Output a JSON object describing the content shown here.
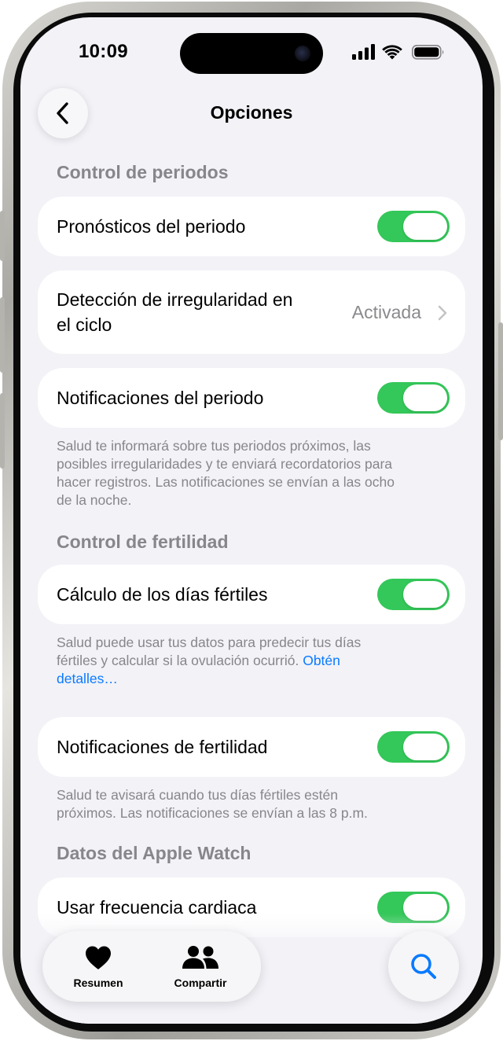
{
  "status_bar": {
    "time": "10:09"
  },
  "nav": {
    "title": "Opciones",
    "back": "back"
  },
  "sections": {
    "period": {
      "header": "Control de periodos",
      "forecasts": {
        "label": "Pronósticos del periodo",
        "on": true
      },
      "irregularity": {
        "line1": "Detección de irregularidad en",
        "line2": "el ciclo",
        "value": "Activada"
      },
      "notifications": {
        "label": "Notificaciones del periodo",
        "on": true
      },
      "footnote_lines": [
        "Salud te informará sobre tus periodos próximos, las",
        "posibles irregularidades y te enviará recordatorios para",
        "hacer registros. Las notificaciones se envían a las ocho",
        "de la noche."
      ]
    },
    "fertility": {
      "header": "Control de fertilidad",
      "estimate": {
        "label": "Cálculo de los días fértiles",
        "on": true
      },
      "footnote_line1": "Salud puede usar tus datos para predecir tus días",
      "footnote_line2": "fértiles y calcular si la ovulación ocurrió.",
      "footnote_link1": "Obtén",
      "footnote_link2": "detalles…",
      "notifications": {
        "label": "Notificaciones de fertilidad",
        "on": true
      },
      "notif_footnote_lines": [
        "Salud te avisará cuando tus días fértiles estén",
        "próximos. Las notificaciones se envían a las 8 p.m."
      ]
    },
    "watch": {
      "header": "Datos del Apple Watch",
      "heart_rate": {
        "label": "Usar frecuencia cardiaca",
        "on": true
      }
    }
  },
  "tabbar": {
    "summary": {
      "label": "Resumen",
      "icon": "heart-icon"
    },
    "sharing": {
      "label": "Compartir",
      "icon": "people-icon"
    },
    "search": {
      "icon": "search-icon"
    }
  },
  "colors": {
    "toggle_on": "#34c759",
    "background": "#f2f2f7",
    "link": "#0a7aff",
    "secondary_text": "#86868b"
  }
}
